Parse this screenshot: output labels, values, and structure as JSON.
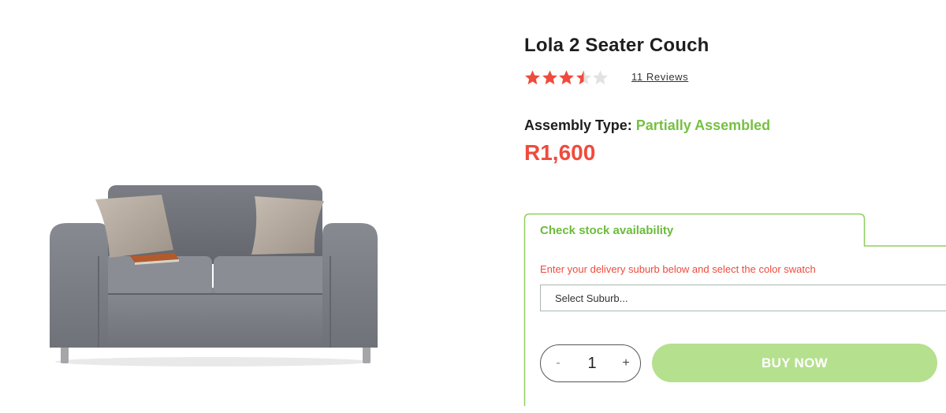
{
  "product": {
    "title": "Lola 2 Seater Couch",
    "rating": {
      "value": 3.5,
      "max": 5
    },
    "reviews_label": "11  Reviews",
    "assembly_label": "Assembly Type:",
    "assembly_value": "Partially Assembled",
    "price": "R1,600",
    "image_icon": "sofa-image"
  },
  "stock": {
    "tab_label": "Check stock availability",
    "delivery_note": "Enter your delivery suburb below and select the color swatch",
    "suburb_select": "Select Suburb...",
    "quantity": "1",
    "minus_label": "-",
    "plus_label": "+",
    "buy_label": "BUY NOW"
  },
  "colors": {
    "accent_green": "#77c043",
    "price_red": "#ef4b3c",
    "star_filled": "#ef4b3c",
    "star_empty": "#e2e2e2",
    "buy_button": "#b5e08e"
  }
}
